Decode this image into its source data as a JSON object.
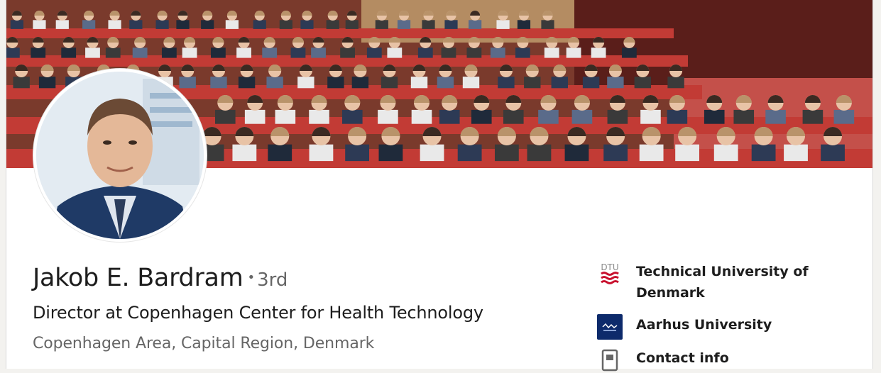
{
  "profile": {
    "name": "Jakob E. Bardram",
    "degree_separator": "•",
    "degree": "3rd",
    "headline": "Director at Copenhagen Center for Health Technology",
    "location": "Copenhagen Area, Capital Region, Denmark"
  },
  "cover": {
    "description_icon": "auditorium-photo"
  },
  "education": [
    {
      "name": "Technical University of Denmark",
      "logo_text": "DTU",
      "logo_color": "#c8102e"
    },
    {
      "name": "Aarhus University",
      "logo_color": "#0d2a6b"
    },
    {
      "name": "Contact info",
      "icon": "contact-card-icon"
    }
  ],
  "colors": {
    "seat_red": "#c8453e",
    "text_primary": "#1d1d1d",
    "text_secondary": "#666666"
  }
}
